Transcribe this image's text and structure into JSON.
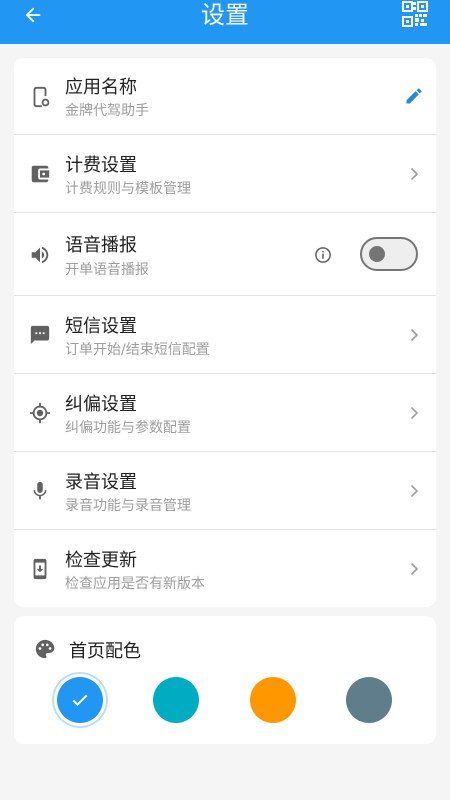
{
  "header": {
    "title": "设置",
    "back_icon": "arrow-left-icon",
    "qr_icon": "qr-code-icon"
  },
  "settings": {
    "items": [
      {
        "title": "应用名称",
        "subtitle": "金牌代驾助手",
        "icon": "app-phone-gear-icon",
        "trailing": "pencil-icon"
      },
      {
        "title": "计费设置",
        "subtitle": "计费规则与模板管理",
        "icon": "wallet-icon",
        "trailing": "chevron-right-icon"
      },
      {
        "title": "语音播报",
        "subtitle": "开单语音播报",
        "icon": "speaker-icon",
        "trailing": "toggle",
        "toggle_on": false
      },
      {
        "title": "短信设置",
        "subtitle": "订单开始/结束短信配置",
        "icon": "message-icon",
        "trailing": "chevron-right-icon"
      },
      {
        "title": "纠偏设置",
        "subtitle": "纠偏功能与参数配置",
        "icon": "crosshair-icon",
        "trailing": "chevron-right-icon"
      },
      {
        "title": "录音设置",
        "subtitle": "录音功能与录音管理",
        "icon": "microphone-icon",
        "trailing": "chevron-right-icon"
      },
      {
        "title": "检查更新",
        "subtitle": "检查应用是否有新版本",
        "icon": "phone-download-icon",
        "trailing": "chevron-right-icon"
      }
    ]
  },
  "home_color": {
    "label": "首页配色",
    "icon": "palette-icon",
    "swatches": [
      {
        "color": "#2196f3",
        "selected": true
      },
      {
        "color": "#00acc1",
        "selected": false
      },
      {
        "color": "#ff9800",
        "selected": false
      },
      {
        "color": "#607d8b",
        "selected": false
      }
    ]
  },
  "colors": {
    "primary": "#2196f3",
    "background": "#f5f5f5"
  }
}
